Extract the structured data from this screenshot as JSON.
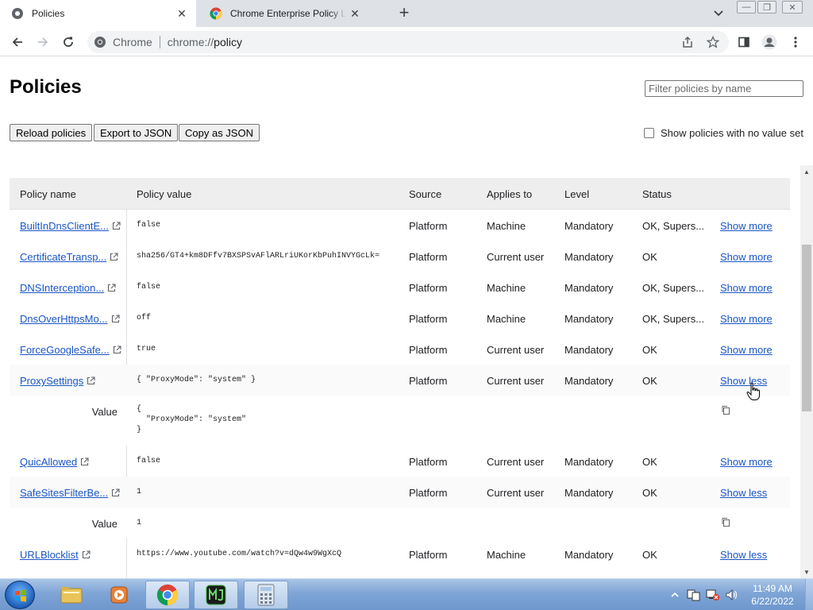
{
  "tabs": [
    {
      "title": "Policies",
      "active": true
    },
    {
      "title": "Chrome Enterprise Policy List & M",
      "active": false
    }
  ],
  "omnibox": {
    "site_chip": "Chrome",
    "url_scheme": "chrome://",
    "url_host": "policy"
  },
  "page": {
    "title": "Policies",
    "filter_placeholder": "Filter policies by name",
    "buttons": {
      "reload": "Reload policies",
      "export": "Export to JSON",
      "copy": "Copy as JSON"
    },
    "no_value_label": "Show policies with no value set"
  },
  "table": {
    "headers": {
      "name": "Policy name",
      "value": "Policy value",
      "source": "Source",
      "applies": "Applies to",
      "level": "Level",
      "status": "Status"
    },
    "value_label": "Value",
    "rows": [
      {
        "name": "BuiltInDnsClientE...",
        "value": "false",
        "source": "Platform",
        "applies": "Machine",
        "level": "Mandatory",
        "status": "OK, Supers...",
        "toggle": "Show more"
      },
      {
        "name": "CertificateTransp...",
        "value": "sha256/GT4+km8DFfv7BXSPSvAFlARLriUKorKbPuhINVYGcLk=",
        "source": "Platform",
        "applies": "Current user",
        "level": "Mandatory",
        "status": "OK",
        "toggle": "Show more"
      },
      {
        "name": "DNSInterception...",
        "value": "false",
        "source": "Platform",
        "applies": "Machine",
        "level": "Mandatory",
        "status": "OK, Supers...",
        "toggle": "Show more"
      },
      {
        "name": "DnsOverHttpsMo...",
        "value": "off",
        "source": "Platform",
        "applies": "Machine",
        "level": "Mandatory",
        "status": "OK, Supers...",
        "toggle": "Show more"
      },
      {
        "name": "ForceGoogleSafe...",
        "value": "true",
        "source": "Platform",
        "applies": "Current user",
        "level": "Mandatory",
        "status": "OK",
        "toggle": "Show more"
      },
      {
        "name": "ProxySettings",
        "value": "{ \"ProxyMode\": \"system\" }",
        "source": "Platform",
        "applies": "Current user",
        "level": "Mandatory",
        "status": "OK",
        "toggle": "Show less",
        "expanded_value": "{\n  \"ProxyMode\": \"system\"\n}"
      },
      {
        "name": "QuicAllowed",
        "value": "false",
        "source": "Platform",
        "applies": "Current user",
        "level": "Mandatory",
        "status": "OK",
        "toggle": "Show more"
      },
      {
        "name": "SafeSitesFilterBe...",
        "value": "1",
        "source": "Platform",
        "applies": "Current user",
        "level": "Mandatory",
        "status": "OK",
        "toggle": "Show less",
        "expanded_value": "1"
      },
      {
        "name": "URLBlocklist",
        "value": "https://www.youtube.com/watch?v=dQw4w9WgXcQ",
        "source": "Platform",
        "applies": "Machine",
        "level": "Mandatory",
        "status": "OK",
        "toggle": "Show less"
      }
    ]
  },
  "taskbar": {
    "clock_time": "11:49 AM",
    "clock_date": "6/22/2022",
    "apps": [
      "file-explorer-icon",
      "media-player-icon",
      "chrome-icon",
      "mj-app-icon",
      "calculator-icon"
    ]
  }
}
